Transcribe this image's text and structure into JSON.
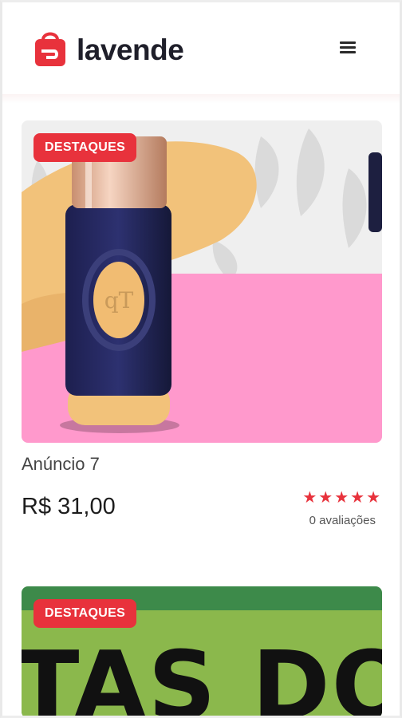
{
  "brand": {
    "name": "lavende"
  },
  "products": [
    {
      "badge": "DESTAQUES",
      "title": "Anúncio 7",
      "price": "R$ 31,00",
      "stars": "★★★★★",
      "reviews": "0 avaliações"
    },
    {
      "badge": "DESTAQUES",
      "banner_text": "TAS DO"
    }
  ],
  "colors": {
    "accent": "#e8323c",
    "pink": "#ff99cc",
    "green": "#3d8a4a"
  }
}
